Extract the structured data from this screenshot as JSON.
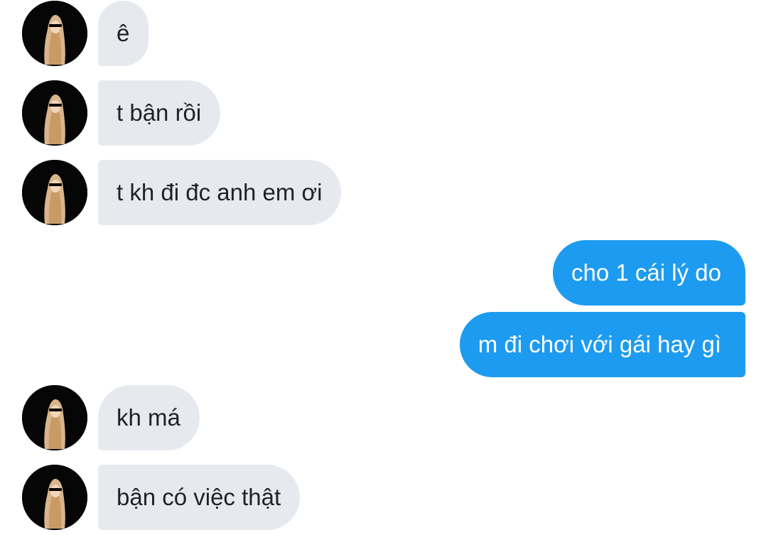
{
  "conversation": {
    "messages": [
      {
        "sender": "them",
        "text": "ê",
        "avatar": "profile-photo"
      },
      {
        "sender": "them",
        "text": "t bận rồi",
        "avatar": "profile-photo"
      },
      {
        "sender": "them",
        "text": "t kh đi đc anh em ơi",
        "avatar": "profile-photo"
      },
      {
        "sender": "me",
        "text": "cho 1 cái lý do"
      },
      {
        "sender": "me",
        "text": "m đi chơi với gái hay gì"
      },
      {
        "sender": "them",
        "text": "kh má",
        "avatar": "profile-photo"
      },
      {
        "sender": "them",
        "text": "bận có việc thật",
        "avatar": "profile-photo"
      }
    ]
  },
  "colors": {
    "incoming_bubble": "#e6eaee",
    "incoming_text": "#1f2226",
    "outgoing_bubble": "#1d9bf0",
    "outgoing_text": "#ffffff",
    "avatar_background": "#060606"
  }
}
